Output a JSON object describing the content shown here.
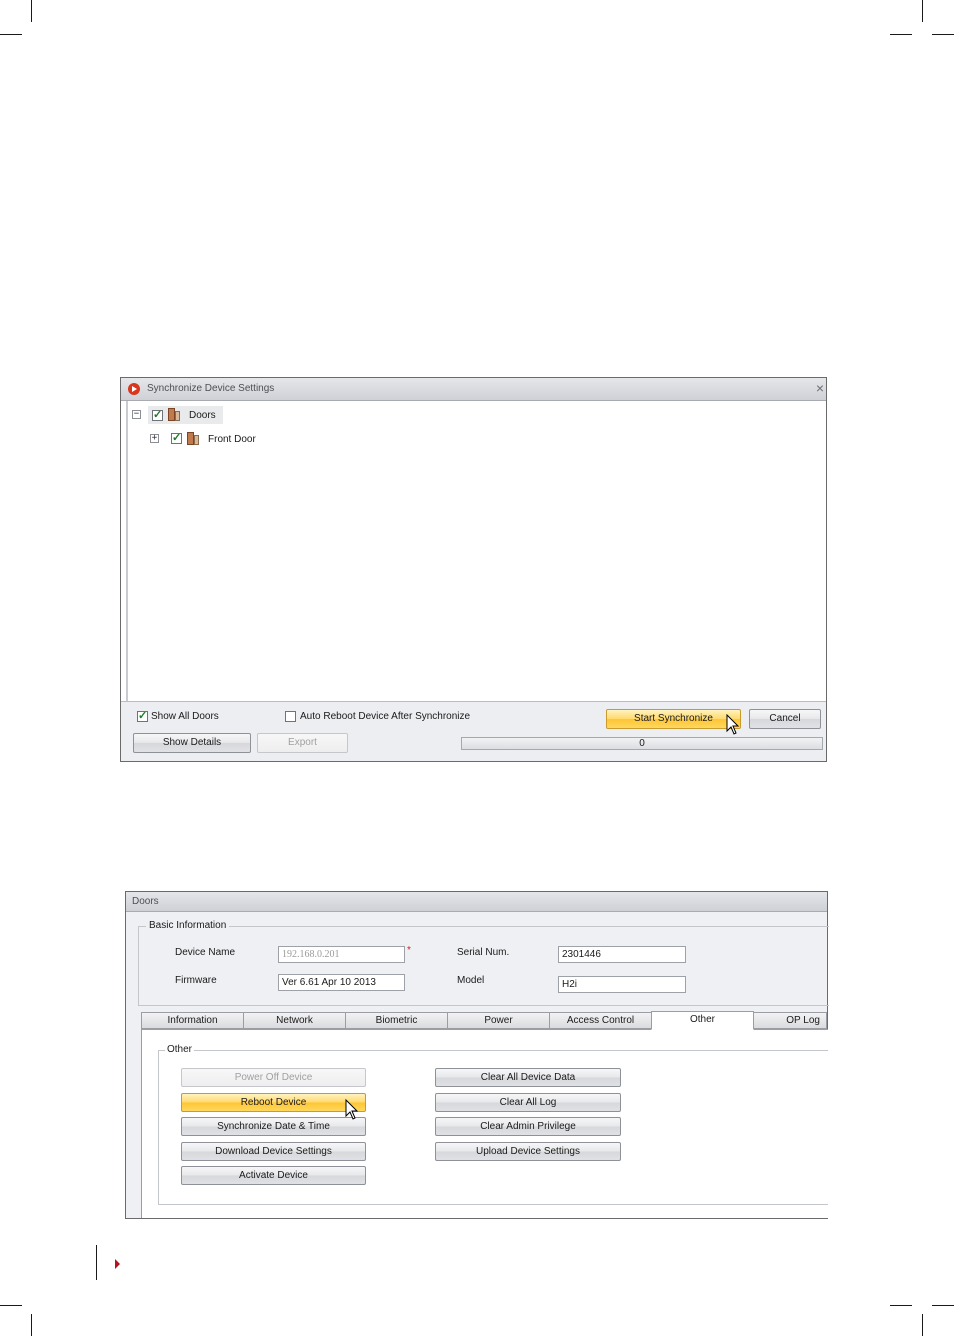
{
  "sync_dialog": {
    "title": "Synchronize Device Settings",
    "close_glyph": "×",
    "tree": {
      "root_label": "Doors",
      "root_checked": true,
      "root_expander": "−",
      "child_label": "Front Door",
      "child_checked": true,
      "child_expander": "+"
    },
    "show_all_doors": {
      "label": "Show All Doors",
      "checked": true
    },
    "auto_reboot": {
      "label": "Auto Reboot Device After Synchronize",
      "checked": false
    },
    "buttons": {
      "start": "Start Synchronize",
      "cancel": "Cancel",
      "show_details": "Show Details",
      "export": "Export"
    },
    "progress": {
      "value_text": "0",
      "fraction": 0
    }
  },
  "doors_panel": {
    "title": "Doors",
    "basic_info": {
      "legend": "Basic Information",
      "device_name_label": "Device Name",
      "device_name_value": "192.168.0.201",
      "required_mark": "*",
      "serial_label": "Serial Num.",
      "serial_value": "2301446",
      "firmware_label": "Firmware",
      "firmware_value": "Ver 6.61 Apr 10 2013",
      "model_label": "Model",
      "model_value": "H2i"
    },
    "tabs": [
      "Information",
      "Network",
      "Biometric",
      "Power",
      "Access Control",
      "Other",
      "OP Log"
    ],
    "active_tab": "Other",
    "other_group": {
      "legend": "Other",
      "left_buttons": [
        "Power Off Device",
        "Reboot Device",
        "Synchronize Date & Time",
        "Download Device Settings",
        "Activate Device"
      ],
      "right_buttons": [
        "Clear All Device Data",
        "Clear All Log",
        "Clear Admin Privilege",
        "Upload Device Settings"
      ]
    }
  },
  "colors": {
    "highlight_button": "#ffd24a",
    "title_icon": "#d9361c",
    "page_marker": "#b3121f"
  }
}
